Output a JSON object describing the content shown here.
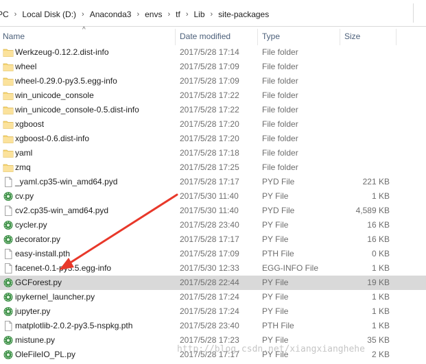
{
  "breadcrumb": [
    "PC",
    "Local Disk (D:)",
    "Anaconda3",
    "envs",
    "tf",
    "Lib",
    "site-packages"
  ],
  "columns": {
    "name": "Name",
    "date": "Date modified",
    "type": "Type",
    "size": "Size"
  },
  "sort_indicator": "^",
  "files": [
    {
      "name": "Werkzeug-0.12.2.dist-info",
      "date": "2017/5/28 17:14",
      "type": "File folder",
      "size": "",
      "icon": "folder-icon"
    },
    {
      "name": "wheel",
      "date": "2017/5/28 17:09",
      "type": "File folder",
      "size": "",
      "icon": "folder-icon"
    },
    {
      "name": "wheel-0.29.0-py3.5.egg-info",
      "date": "2017/5/28 17:09",
      "type": "File folder",
      "size": "",
      "icon": "folder-icon"
    },
    {
      "name": "win_unicode_console",
      "date": "2017/5/28 17:22",
      "type": "File folder",
      "size": "",
      "icon": "folder-icon"
    },
    {
      "name": "win_unicode_console-0.5.dist-info",
      "date": "2017/5/28 17:22",
      "type": "File folder",
      "size": "",
      "icon": "folder-icon"
    },
    {
      "name": "xgboost",
      "date": "2017/5/28 17:20",
      "type": "File folder",
      "size": "",
      "icon": "folder-icon"
    },
    {
      "name": "xgboost-0.6.dist-info",
      "date": "2017/5/28 17:20",
      "type": "File folder",
      "size": "",
      "icon": "folder-icon"
    },
    {
      "name": "yaml",
      "date": "2017/5/28 17:18",
      "type": "File folder",
      "size": "",
      "icon": "folder-icon"
    },
    {
      "name": "zmq",
      "date": "2017/5/28 17:25",
      "type": "File folder",
      "size": "",
      "icon": "folder-icon"
    },
    {
      "name": "_yaml.cp35-win_amd64.pyd",
      "date": "2017/5/28 17:17",
      "type": "PYD File",
      "size": "221 KB",
      "icon": "file-icon"
    },
    {
      "name": "cv.py",
      "date": "2017/5/30 11:40",
      "type": "PY File",
      "size": "1 KB",
      "icon": "python-file-icon"
    },
    {
      "name": "cv2.cp35-win_amd64.pyd",
      "date": "2017/5/30 11:40",
      "type": "PYD File",
      "size": "4,589 KB",
      "icon": "file-icon"
    },
    {
      "name": "cycler.py",
      "date": "2017/5/28 23:40",
      "type": "PY File",
      "size": "16 KB",
      "icon": "python-file-icon"
    },
    {
      "name": "decorator.py",
      "date": "2017/5/28 17:17",
      "type": "PY File",
      "size": "16 KB",
      "icon": "python-file-icon"
    },
    {
      "name": "easy-install.pth",
      "date": "2017/5/28 17:09",
      "type": "PTH File",
      "size": "0 KB",
      "icon": "file-icon"
    },
    {
      "name": "facenet-0.1-py3.5.egg-info",
      "date": "2017/5/30 12:33",
      "type": "EGG-INFO File",
      "size": "1 KB",
      "icon": "file-icon"
    },
    {
      "name": "GCForest.py",
      "date": "2017/5/28 22:44",
      "type": "PY File",
      "size": "19 KB",
      "icon": "python-file-icon",
      "selected": true
    },
    {
      "name": "ipykernel_launcher.py",
      "date": "2017/5/28 17:24",
      "type": "PY File",
      "size": "1 KB",
      "icon": "python-file-icon"
    },
    {
      "name": "jupyter.py",
      "date": "2017/5/28 17:24",
      "type": "PY File",
      "size": "1 KB",
      "icon": "python-file-icon"
    },
    {
      "name": "matplotlib-2.0.2-py3.5-nspkg.pth",
      "date": "2017/5/28 23:40",
      "type": "PTH File",
      "size": "1 KB",
      "icon": "file-icon"
    },
    {
      "name": "mistune.py",
      "date": "2017/5/28 17:23",
      "type": "PY File",
      "size": "35 KB",
      "icon": "python-file-icon"
    },
    {
      "name": "OleFileIO_PL.py",
      "date": "2017/5/28 17:17",
      "type": "PY File",
      "size": "2 KB",
      "icon": "python-file-icon"
    }
  ],
  "watermark": "http://blog.csdn.net/xiangxianghehe",
  "colors": {
    "selection": "#d9d9d9",
    "header_text": "#4c607a",
    "arrow": "#e8382a",
    "folder": "#f8d775"
  }
}
